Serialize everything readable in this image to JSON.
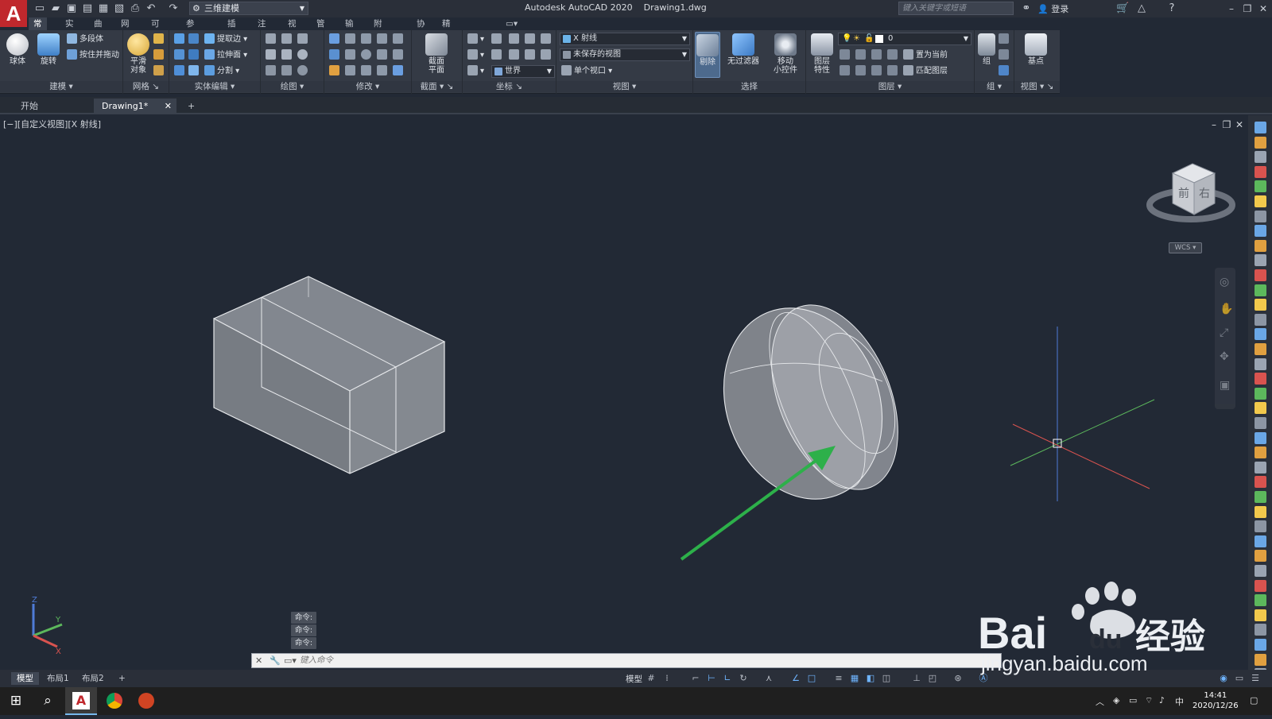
{
  "app": {
    "logo": "A",
    "title": "Autodesk AutoCAD 2020",
    "file": "Drawing1.dwg"
  },
  "quick_access": {
    "workspace": "三维建模",
    "search_placeholder": "键入关键字或短语",
    "login": "登录"
  },
  "ribbon_tabs": [
    "常用",
    "实体",
    "曲面",
    "网格",
    "可视化",
    "参数化",
    "插入",
    "注释",
    "视图",
    "管理",
    "输出",
    "附加模块",
    "协作",
    "精选应用"
  ],
  "active_tab": "常用",
  "panels": {
    "build": {
      "title": "建模",
      "sphere": "球体",
      "revolve": "旋转",
      "polysolid": "多段体",
      "presspull": "按住并拖动"
    },
    "mesh": {
      "title": "网格",
      "smooth_line1": "平滑",
      "smooth_line2": "对象"
    },
    "solid_edit": {
      "title": "实体编辑",
      "extract": "提取边",
      "extrude": "拉伸面",
      "separate": "分割"
    },
    "draw": {
      "title": "绘图"
    },
    "modify": {
      "title": "修改"
    },
    "section": {
      "title": "截面",
      "plane_line1": "截面",
      "plane_line2": "平面"
    },
    "coordinates": {
      "title": "坐标",
      "world": "世界"
    },
    "view": {
      "title": "视图",
      "visual_style": "X 射线",
      "saved_view": "未保存的视图",
      "viewport": "单个视口"
    },
    "selection": {
      "title": "选择",
      "cull": "剔除",
      "no_filter": "无过滤器",
      "gizmo_line1": "移动",
      "gizmo_line2": "小控件"
    },
    "layers": {
      "title": "图层",
      "layer_props_line1": "图层",
      "layer_props_line2": "特性",
      "current_layer": "0",
      "set_current": "置为当前",
      "match_layer": "匹配图层"
    },
    "groups": {
      "title": "组",
      "group": "组"
    },
    "view2": {
      "title": "视图",
      "base": "基点"
    }
  },
  "doc_tabs": {
    "start": "开始",
    "drawing": "Drawing1*"
  },
  "viewport": {
    "label": "[−][自定义视图][X 射线]",
    "wcs": "WCS"
  },
  "viewcube": {
    "front": "前",
    "right": "右"
  },
  "command": {
    "history": [
      "命令:",
      "命令:",
      "命令:"
    ],
    "placeholder": "键入命令"
  },
  "layout_tabs": [
    "模型",
    "布局1",
    "布局2"
  ],
  "status": {
    "model": "模型"
  },
  "taskbar": {
    "time": "14:41",
    "date": "2020/12/26",
    "ime": "中"
  },
  "watermark": {
    "brand": "Bai",
    "brand2": "du",
    "cn": "经验",
    "url": "jingyan.baidu.com"
  },
  "colors": {
    "canvas": "#222935",
    "ribbon": "#343a45",
    "arrow": "#2db04a",
    "x_axis": "#d9534f",
    "y_axis": "#5cb85c",
    "z_axis": "#4f7bd6"
  }
}
